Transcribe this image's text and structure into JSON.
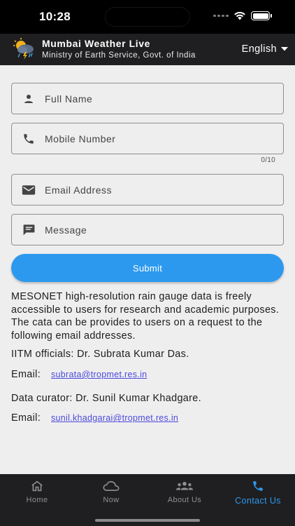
{
  "status": {
    "time": "10:28"
  },
  "header": {
    "title": "Mumbai Weather Live",
    "subtitle": "Ministry of Earth Service, Govt. of India",
    "language": "English"
  },
  "form": {
    "full_name": {
      "placeholder": "Full Name",
      "value": ""
    },
    "mobile": {
      "placeholder": "Mobile Number",
      "value": "",
      "counter": "0/10"
    },
    "email": {
      "placeholder": "Email Address",
      "value": ""
    },
    "message": {
      "placeholder": "Message",
      "value": ""
    },
    "submit_label": "Submit"
  },
  "info": {
    "paragraph": "MESONET high-resolution rain gauge data is freely accessible to users for research and academic purposes. The cata can be provides to users on a request to the following email addresses.",
    "officials": "IITM officials: Dr. Subrata Kumar Das.",
    "email_label_1": "Email:",
    "email_1": "subrata@tropmet.res.in",
    "curator": "Data curator: Dr. Sunil Kumar Khadgare.",
    "email_label_2": "Email:",
    "email_2": "sunil.khadgarai@tropmet.res.in"
  },
  "nav": {
    "items": [
      {
        "label": "Home",
        "icon": "home-icon"
      },
      {
        "label": "Now",
        "icon": "cloud-icon"
      },
      {
        "label": "About Us",
        "icon": "group-icon"
      },
      {
        "label": "Contact Us",
        "icon": "phone-icon",
        "active": true
      }
    ]
  },
  "colors": {
    "accent": "#2c99ef",
    "header_bg": "#1f1f21",
    "page_bg": "#efeeef",
    "link": "#4a4adb"
  }
}
